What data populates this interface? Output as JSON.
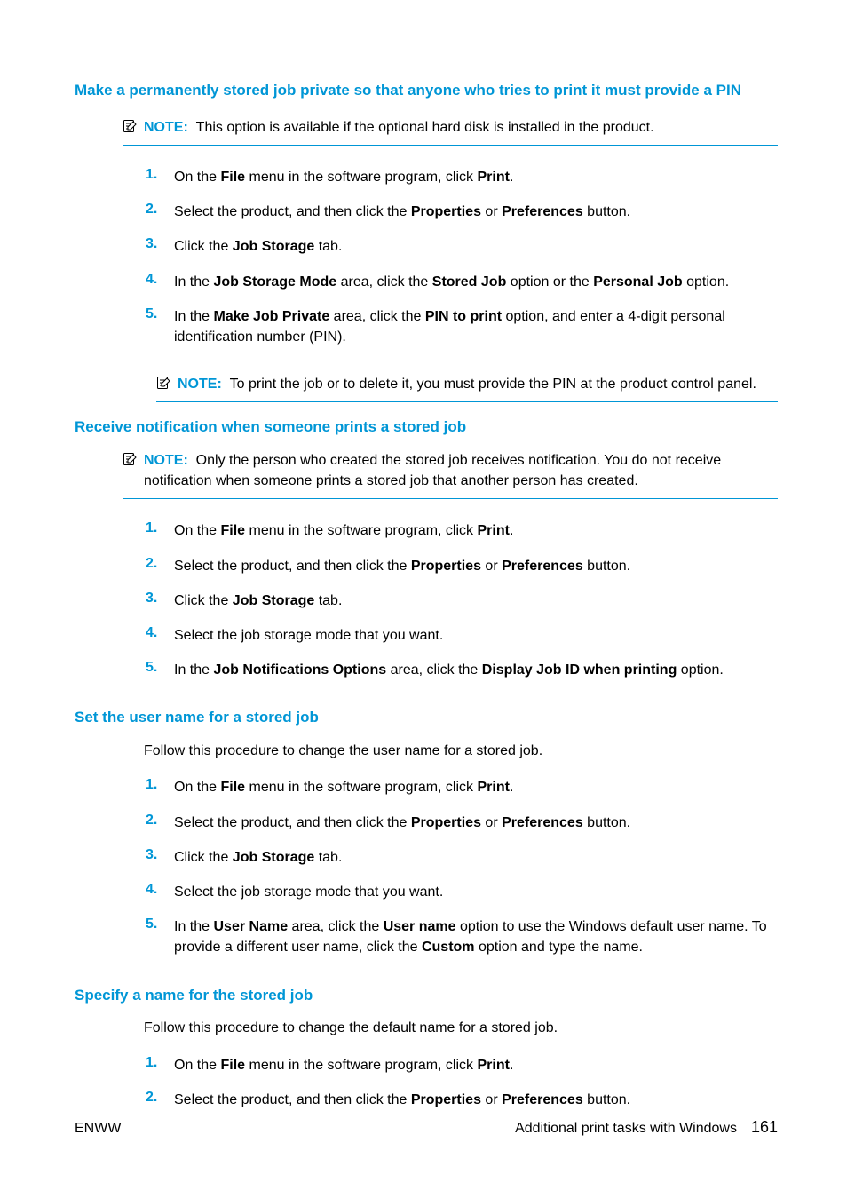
{
  "sections": [
    {
      "title": "Make a permanently stored job private so that anyone who tries to print it must provide a PIN",
      "notes_top": [
        {
          "label": "NOTE:",
          "text": "This option is available if the optional hard disk is installed in the product."
        }
      ],
      "steps": [
        {
          "n": "1.",
          "html": "On the <b>File</b> menu in the software program, click <b>Print</b>."
        },
        {
          "n": "2.",
          "html": "Select the product, and then click the <b>Properties</b> or <b>Preferences</b> button."
        },
        {
          "n": "3.",
          "html": "Click the <b>Job Storage</b> tab."
        },
        {
          "n": "4.",
          "html": "In the <b>Job Storage Mode</b> area, click the <b>Stored Job</b> option or the <b>Personal Job</b> option."
        },
        {
          "n": "5.",
          "html": "In the <b>Make Job Private</b> area, click the <b>PIN to print</b> option, and enter a 4-digit personal identification number (PIN)."
        }
      ],
      "notes_bottom": [
        {
          "label": "NOTE:",
          "text": "To print the job or to delete it, you must provide the PIN at the product control panel."
        }
      ]
    },
    {
      "title": "Receive notification when someone prints a stored job",
      "notes_top": [
        {
          "label": "NOTE:",
          "text": "Only the person who created the stored job receives notification. You do not receive notification when someone prints a stored job that another person has created."
        }
      ],
      "steps": [
        {
          "n": "1.",
          "html": "On the <b>File</b> menu in the software program, click <b>Print</b>."
        },
        {
          "n": "2.",
          "html": "Select the product, and then click the <b>Properties</b> or <b>Preferences</b> button."
        },
        {
          "n": "3.",
          "html": "Click the <b>Job Storage</b> tab."
        },
        {
          "n": "4.",
          "html": "Select the job storage mode that you want."
        },
        {
          "n": "5.",
          "html": "In the <b>Job Notifications Options</b> area, click the <b>Display Job ID when printing</b> option."
        }
      ]
    },
    {
      "title": "Set the user name for a stored job",
      "intro": "Follow this procedure to change the user name for a stored job.",
      "steps": [
        {
          "n": "1.",
          "html": "On the <b>File</b> menu in the software program, click <b>Print</b>."
        },
        {
          "n": "2.",
          "html": "Select the product, and then click the <b>Properties</b> or <b>Preferences</b> button."
        },
        {
          "n": "3.",
          "html": "Click the <b>Job Storage</b> tab."
        },
        {
          "n": "4.",
          "html": "Select the job storage mode that you want."
        },
        {
          "n": "5.",
          "html": "In the <b>User Name</b> area, click the <b>User name</b> option to use the Windows default user name. To provide a different user name, click the <b>Custom</b> option and type the name."
        }
      ]
    },
    {
      "title": "Specify a name for the stored job",
      "intro": "Follow this procedure to change the default name for a stored job.",
      "steps": [
        {
          "n": "1.",
          "html": "On the <b>File</b> menu in the software program, click <b>Print</b>."
        },
        {
          "n": "2.",
          "html": "Select the product, and then click the <b>Properties</b> or <b>Preferences</b> button."
        }
      ]
    }
  ],
  "footer": {
    "left": "ENWW",
    "right_text": "Additional print tasks with Windows",
    "page": "161"
  },
  "icon_name": "note-icon"
}
